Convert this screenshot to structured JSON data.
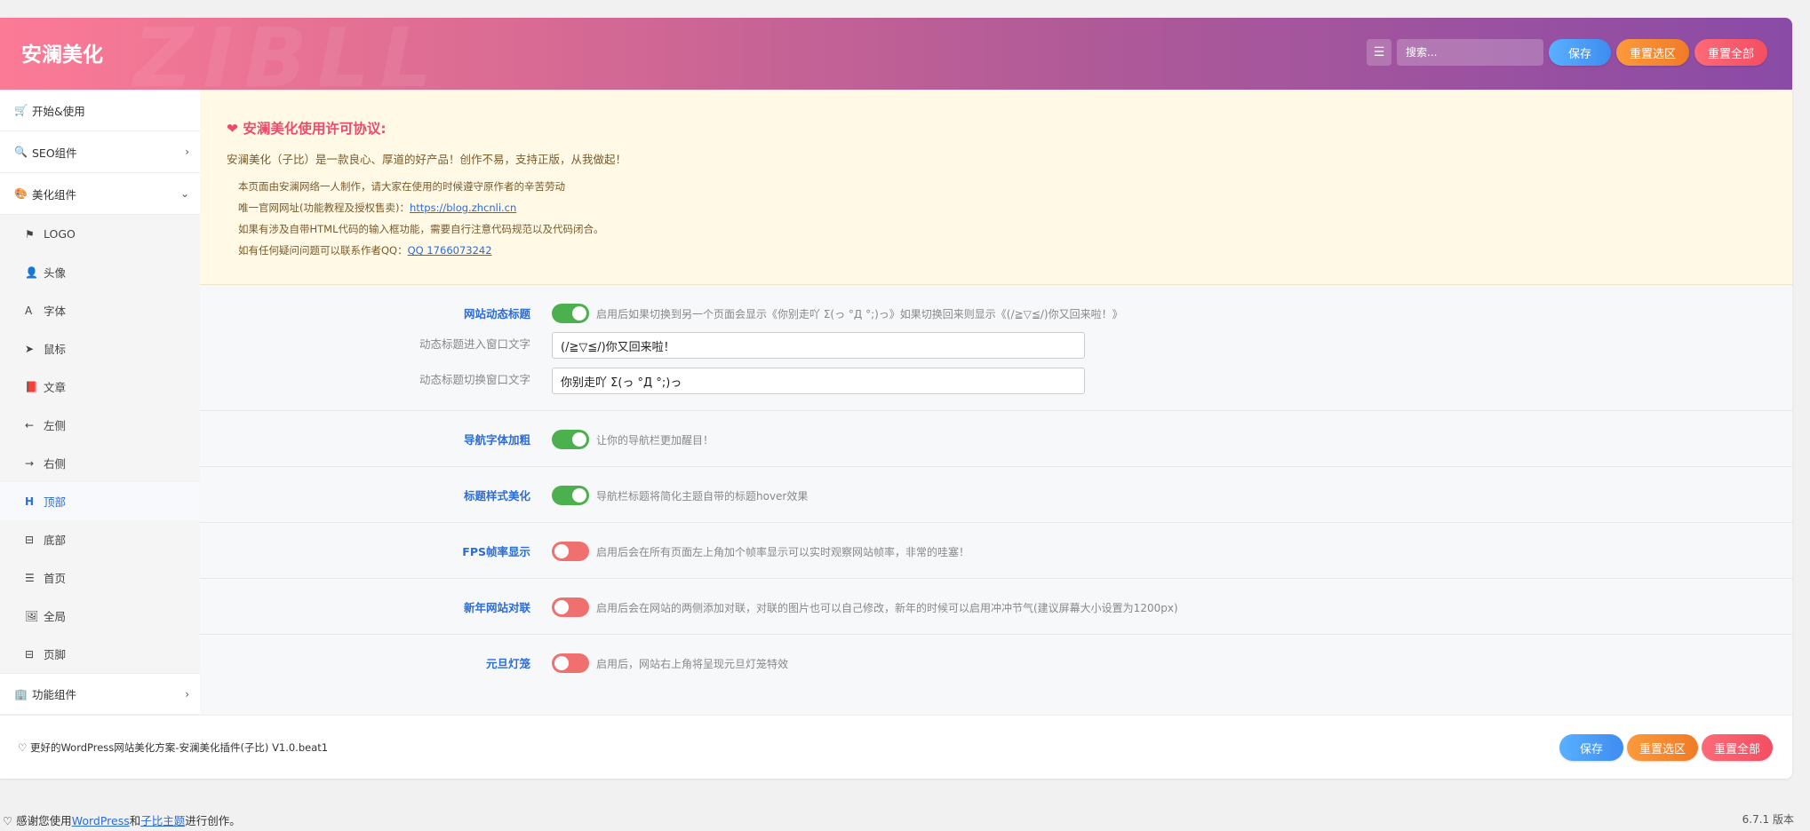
{
  "header": {
    "watermark": "ZIBLL",
    "title": "安澜美化",
    "search_placeholder": "搜索...",
    "save": "保存",
    "reset_section": "重置选区",
    "reset_all": "重置全部"
  },
  "sidebar": {
    "start": "开始&使用",
    "seo": "SEO组件",
    "beautify": "美化组件",
    "sub": [
      "LOGO",
      "头像",
      "字体",
      "鼠标",
      "文章",
      "左侧",
      "右侧",
      "顶部",
      "底部",
      "首页",
      "全局",
      "页脚"
    ],
    "function": "功能组件"
  },
  "notice": {
    "title": "安澜美化使用许可协议:",
    "intro": "安澜美化（子比）是一款良心、厚道的好产品！创作不易，支持正版，从我做起！",
    "line1": "本页面由安澜网络一人制作，请大家在使用的时候遵守原作者的辛苦劳动",
    "line2_prefix": "唯一官网网址(功能教程及授权售卖)：",
    "line2_link": "https://blog.zhcnli.cn",
    "line3": "如果有涉及自带HTML代码的输入框功能，需要自行注意代码规范以及代码闭合。",
    "line4_prefix": "如有任何疑问问题可以联系作者QQ：",
    "line4_link": "QQ 1766073242"
  },
  "settings": {
    "dynamic_title": {
      "label": "网站动态标题",
      "desc": "启用后如果切换到另一个页面会显示《你别走吖 Σ(っ °Д °;)っ》如果切换回来则显示《(/≧▽≦/)你又回来啦！》",
      "enter_label": "动态标题进入窗口文字",
      "enter_value": "(/≧▽≦/)你又回来啦！",
      "switch_label": "动态标题切换窗口文字",
      "switch_value": "你别走吖 Σ(っ °Д °;)っ"
    },
    "nav_bold": {
      "label": "导航字体加粗",
      "desc": "让你的导航栏更加醒目！"
    },
    "title_style": {
      "label": "标题样式美化",
      "desc": "导航栏标题将简化主题自带的标题hover效果"
    },
    "fps": {
      "label": "FPS帧率显示",
      "desc": "启用后会在所有页面左上角加个帧率显示可以实时观察网站帧率，非常的哇塞！"
    },
    "couplet": {
      "label": "新年网站对联",
      "desc": "启用后会在网站的两侧添加对联，对联的图片也可以自己修改，新年的时候可以启用冲冲节气(建议屏幕大小设置为1200px)"
    },
    "lantern": {
      "label": "元旦灯笼",
      "desc": "启用后，网站右上角将呈现元旦灯笼特效"
    }
  },
  "footer": {
    "text": "♡ 更好的WordPress网站美化方案-安澜美化插件(子比) V1.0.beat1",
    "save": "保存",
    "reset_section": "重置选区",
    "reset_all": "重置全部"
  },
  "wp": {
    "prefix": "♡ 感谢您使用",
    "wordpress": "WordPress",
    "and": "和",
    "theme": "子比主题",
    "suffix": "进行创作。",
    "version": "6.7.1 版本"
  },
  "colors": {
    "header_gradient_start": "#fb7b96",
    "header_gradient_end": "#8a4ba6",
    "accent_blue": "#2b6cd8",
    "switch_on": "#4cb04f",
    "switch_off": "#f07070"
  }
}
